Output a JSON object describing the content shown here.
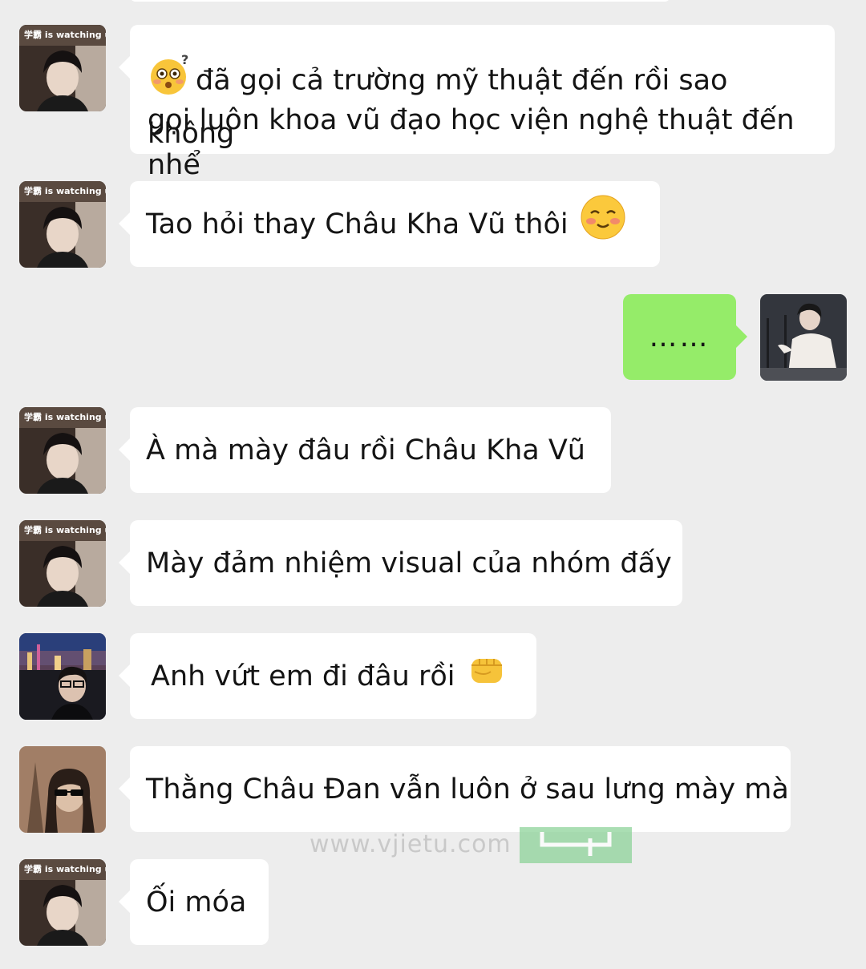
{
  "chat": {
    "avatar_caption": "学霸 is watching u",
    "messages": [
      {
        "text": "đã gọi cả trường mỹ thuật đến rồi sao không gọi luôn khoa vũ đạo học viện nghệ thuật đến nhể",
        "lines": [
          "đã gọi cả trường mỹ thuật đến rồi sao không",
          "gọi luôn khoa vũ đạo học viện nghệ thuật đến nhể"
        ],
        "emoji": "flushed-thinking-emoji"
      },
      {
        "text": "Tao hỏi thay Châu Kha Vũ thôi",
        "emoji": "blushing-smile-emoji"
      },
      {
        "text": "……"
      },
      {
        "text": "À mà mày đâu rồi Châu Kha Vũ"
      },
      {
        "text": "Mày đảm nhiệm visual của nhóm đấy"
      },
      {
        "text": "Anh vứt em đi đâu rồi",
        "emoji": "fist-emoji"
      },
      {
        "text": "Thằng Châu Đan vẫn luôn ở sau lưng mày mà"
      },
      {
        "text": "Ối móa"
      }
    ]
  },
  "watermark": {
    "text": "www.vjietu.com"
  },
  "colors": {
    "background": "#ededed",
    "bubble_incoming": "#ffffff",
    "bubble_outgoing": "#95ec69"
  }
}
